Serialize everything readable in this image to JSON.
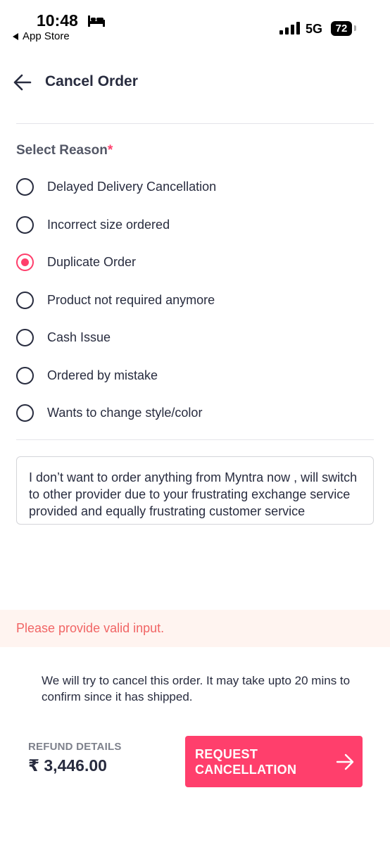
{
  "status_bar": {
    "time": "10:48",
    "back_to_app": "App Store",
    "network": "5G",
    "battery": "72"
  },
  "header": {
    "title": "Cancel Order"
  },
  "reason_section": {
    "label": "Select Reason",
    "required_marker": "*",
    "options": [
      {
        "label": "Delayed Delivery Cancellation",
        "selected": false
      },
      {
        "label": "Incorrect size ordered",
        "selected": false
      },
      {
        "label": "Duplicate Order",
        "selected": true
      },
      {
        "label": "Product not required anymore",
        "selected": false
      },
      {
        "label": "Cash Issue",
        "selected": false
      },
      {
        "label": "Ordered by mistake",
        "selected": false
      },
      {
        "label": "Wants to change style/color",
        "selected": false
      }
    ]
  },
  "comment": {
    "value": "I don’t want to order anything from Myntra now , will switch to other provider due to your frustrating exchange service provided and equally frustrating customer service"
  },
  "error": {
    "message": "Please provide valid input."
  },
  "info": {
    "message": "We will try to cancel this order. It may take upto 20 mins to confirm since it has shipped."
  },
  "footer": {
    "refund_label": "REFUND DETAILS",
    "refund_amount": "₹ 3,446.00",
    "request_button_label": "REQUEST CANCELLATION"
  },
  "colors": {
    "accent": "#ff3f6c",
    "error": "#f16565",
    "error_bg": "#fff4f0"
  }
}
